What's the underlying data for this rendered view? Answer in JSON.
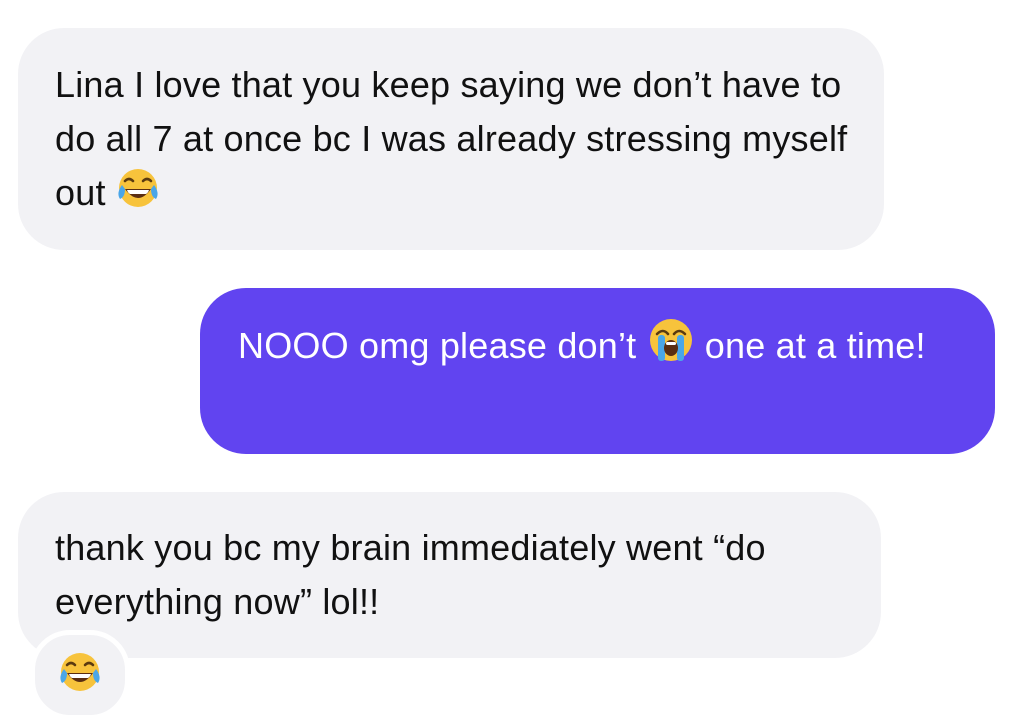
{
  "messages": [
    {
      "direction": "incoming",
      "text": "Lina I love that you keep saying we don’t have to do all 7 at once bc I was already stressing myself out",
      "trailing_emoji": "face-with-tears-of-joy"
    },
    {
      "direction": "outgoing",
      "text_before": "NOOO omg please don’t",
      "emoji": "loudly-crying-face",
      "text_after": "one at a time!"
    },
    {
      "direction": "incoming",
      "text": "thank you bc my brain immediately went “do everything now” lol!!"
    }
  ],
  "reaction": {
    "emoji": "face-with-tears-of-joy"
  },
  "colors": {
    "incoming_bubble": "#f2f2f5",
    "outgoing_bubble": "#6144f0",
    "incoming_text": "#111111",
    "outgoing_text": "#ffffff"
  }
}
